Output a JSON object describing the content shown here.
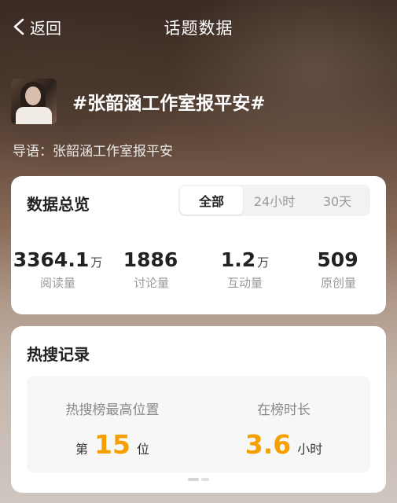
{
  "header": {
    "back_label": "返回",
    "title": "话题数据"
  },
  "topic": {
    "hashtag": "#张韶涵工作室报平安#",
    "intro": "导语：张韶涵工作室报平安"
  },
  "overview": {
    "title": "数据总览",
    "tabs": [
      "全部",
      "24小时",
      "30天"
    ],
    "active_tab": "全部",
    "stats": [
      {
        "value": "3364.1",
        "unit": "万",
        "label": "阅读量"
      },
      {
        "value": "1886",
        "unit": "",
        "label": "讨论量"
      },
      {
        "value": "1.2",
        "unit": "万",
        "label": "互动量"
      },
      {
        "value": "509",
        "unit": "",
        "label": "原创量"
      }
    ]
  },
  "hot_search": {
    "title": "热搜记录",
    "peak_label": "热搜榜最高位置",
    "peak_prefix": "第",
    "peak_value": "15",
    "peak_suffix": "位",
    "duration_label": "在榜时长",
    "duration_value": "3.6",
    "duration_unit": "小时"
  },
  "colors": {
    "accent": "#f5a000"
  }
}
